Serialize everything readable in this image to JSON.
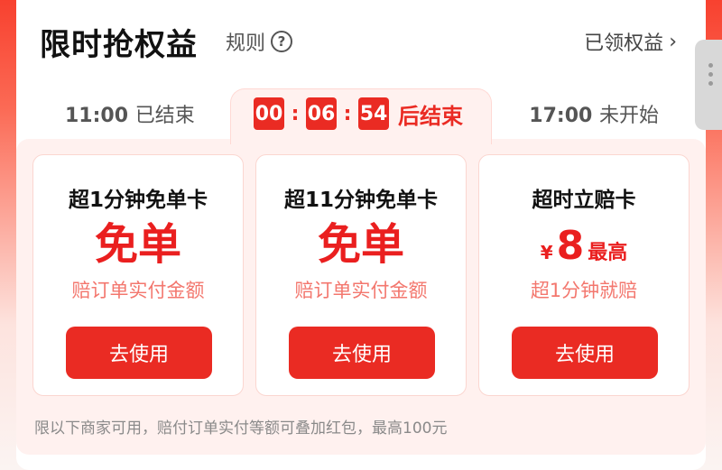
{
  "header": {
    "title": "限时抢权益",
    "rules_label": "规则",
    "help_glyph": "?",
    "claimed_label": "已领权益",
    "chevron_glyph": "›"
  },
  "sessions": {
    "past": {
      "time": "11:00",
      "state": "已结束"
    },
    "current": {
      "hours": "00",
      "minutes": "06",
      "seconds": "54",
      "suffix": "后结束"
    },
    "next": {
      "time": "17:00",
      "state": "未开始"
    }
  },
  "cards": [
    {
      "title": "超1分钟免单卡",
      "value": "免单",
      "subtitle": "赔订单实付金额",
      "button": "去使用"
    },
    {
      "title": "超11分钟免单卡",
      "value": "免单",
      "subtitle": "赔订单实付金额",
      "button": "去使用"
    },
    {
      "title": "超时立赔卡",
      "currency": "¥",
      "amount": "8",
      "amount_suffix": "最高",
      "subtitle": "超1分钟就赔",
      "button": "去使用"
    }
  ],
  "footnote": "限以下商家可用，赔付订单实付等额可叠加红包，最高100元",
  "colors": {
    "accent": "#ea2b23",
    "header_red": "#f8412f",
    "card_subtitle": "#f3776e"
  },
  "icons": {
    "help": "question-circle-icon",
    "chevron": "chevron-right-icon",
    "more": "more-vertical-icon"
  }
}
